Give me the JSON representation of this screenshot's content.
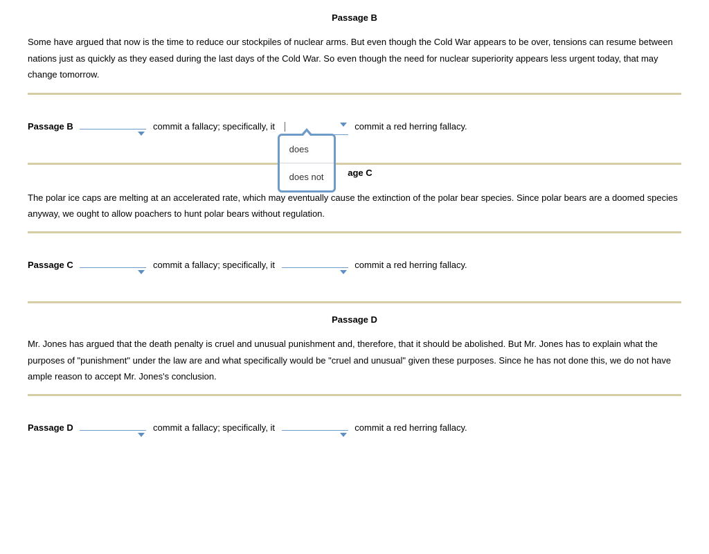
{
  "dropdown_options": [
    "does",
    "does not"
  ],
  "fragments": {
    "frag1": "commit a fallacy; specifically, it",
    "frag2": "commit a red herring fallacy."
  },
  "passages": [
    {
      "id": "B",
      "heading": "Passage B",
      "text": "Some have argued that now is the time to reduce our stockpiles of nuclear arms. But even though the Cold War appears to be over, tensions can resume between nations just as quickly as they eased during the last days of the Cold War. So even though the need for nuclear superiority appears less urgent today, that may change tomorrow.",
      "label": "Passage B",
      "dd1_value": "",
      "dd2_value": "",
      "dd2_open": true
    },
    {
      "id": "C",
      "heading": "Passage C",
      "text": "The polar ice caps are melting at an accelerated rate, which may eventually cause the extinction of the polar bear species. Since polar bears are a doomed species anyway, we ought to allow poachers to hunt polar bears without regulation.",
      "label": "Passage C",
      "dd1_value": "",
      "dd2_value": "",
      "dd2_open": false
    },
    {
      "id": "D",
      "heading": "Passage D",
      "text": "Mr. Jones has argued that the death penalty is cruel and unusual punishment and, therefore, that it should be abolished. But Mr. Jones has to explain what the purposes of \"punishment\" under the law are and what specifically would be \"cruel and unusual\" given these purposes. Since he has not done this, we do not have ample reason to accept Mr. Jones's conclusion.",
      "label": "Passage D",
      "dd1_value": "",
      "dd2_value": "",
      "dd2_open": false
    }
  ]
}
